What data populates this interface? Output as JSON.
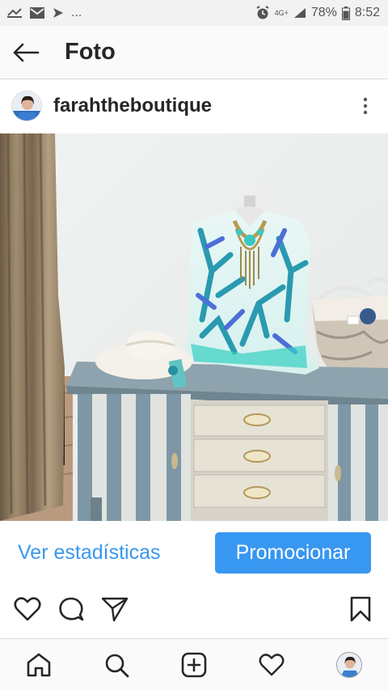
{
  "status_bar": {
    "ellipsis": "...",
    "network": "4G+",
    "battery": "78%",
    "time": "8:52"
  },
  "header": {
    "title": "Foto"
  },
  "post": {
    "username": "farahtheboutique"
  },
  "actions": {
    "insights_label": "Ver estadísticas",
    "promote_label": "Promocionar"
  },
  "colors": {
    "link_blue": "#3897f0",
    "text": "#262626"
  }
}
